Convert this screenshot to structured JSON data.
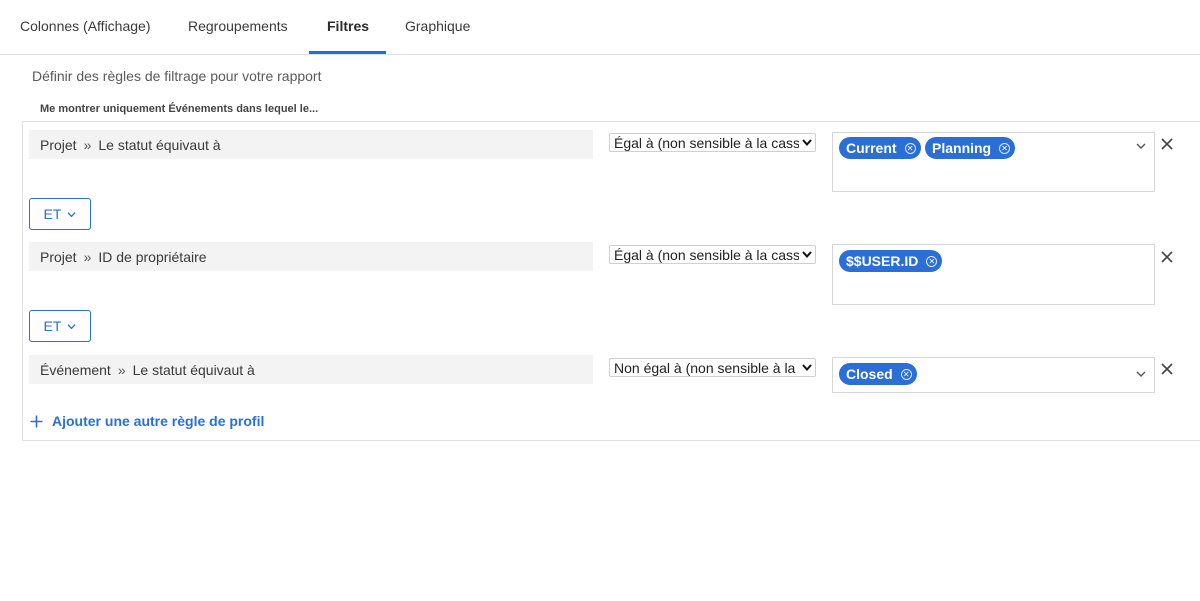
{
  "tabs": [
    {
      "label": "Colonnes (Affichage)",
      "active": false
    },
    {
      "label": "Regroupements",
      "active": false
    },
    {
      "label": "Filtres",
      "active": true
    },
    {
      "label": "Graphique",
      "active": false
    }
  ],
  "description": "Définir des règles de filtrage pour votre rapport",
  "subheader": "Me montrer uniquement Événements dans lequel le...",
  "rules": [
    {
      "object": "Projet",
      "field": "Le statut équivaut à",
      "operator": "Égal à (non sensible à la casse)",
      "values": [
        "Current",
        "Planning"
      ],
      "has_dropdown": true
    },
    {
      "object": "Projet",
      "field": "ID de propriétaire",
      "operator": "Égal à (non sensible à la casse)",
      "values": [
        "$$USER.ID"
      ],
      "has_dropdown": false
    },
    {
      "object": "Événement",
      "field": "Le statut équivaut à",
      "operator": "Non égal à (non sensible à la casse)",
      "values": [
        "Closed"
      ],
      "has_dropdown": true
    }
  ],
  "conjunctions": [
    "ET",
    "ET"
  ],
  "add_rule_label": "Ajouter une autre règle de profil",
  "colors": {
    "accent": "#2b6fd6",
    "tab_underline": "#1d6fdc",
    "field_background": "#f3f3f3"
  }
}
